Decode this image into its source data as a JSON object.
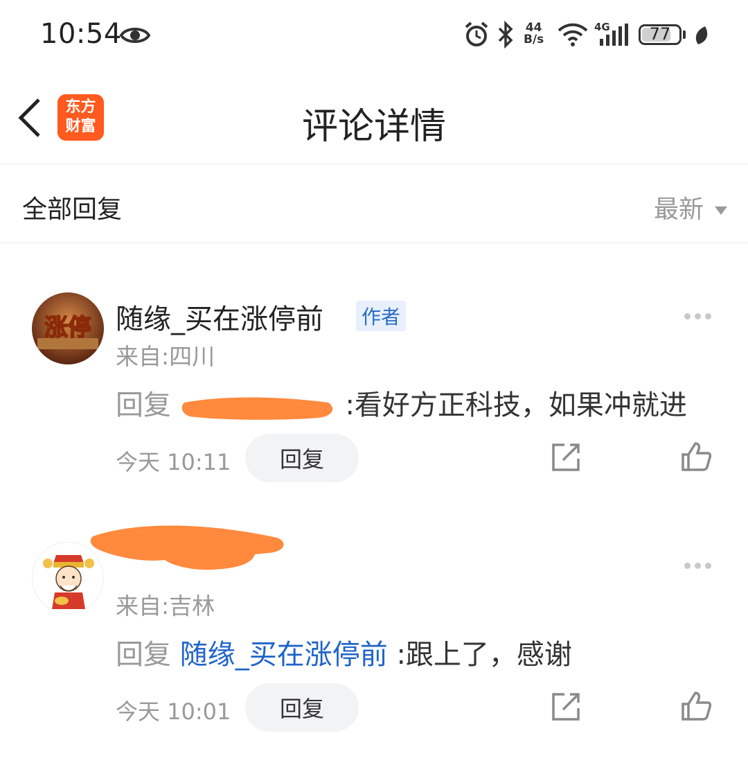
{
  "status_bar": {
    "time": "10:54",
    "net_speed_value": "44",
    "net_speed_unit": "B/s",
    "network_type": "4G",
    "battery": "77"
  },
  "header": {
    "title": "评论详情",
    "app_logo_line1": "东方",
    "app_logo_line2": "财富"
  },
  "filter": {
    "label": "全部回复",
    "sort": "最新"
  },
  "comments": [
    {
      "username": "随缘_买在涨停前",
      "badge": "作者",
      "from": "来自:四川",
      "reply_prefix": "回复",
      "text": ":看好方正科技，如果冲就进",
      "time": "今天 10:11",
      "reply_button": "回复",
      "avatar_text": "涨停"
    },
    {
      "username": "",
      "from": "来自:吉林",
      "reply_prefix": "回复",
      "reply_target": "随缘_买在涨停前",
      "text": ":跟上了，感谢",
      "time": "今天 10:01",
      "reply_button": "回复"
    }
  ],
  "colors": {
    "accent": "#1e64c8",
    "app_logo": "#ff5a1f",
    "redaction": "#ff8a3d"
  }
}
